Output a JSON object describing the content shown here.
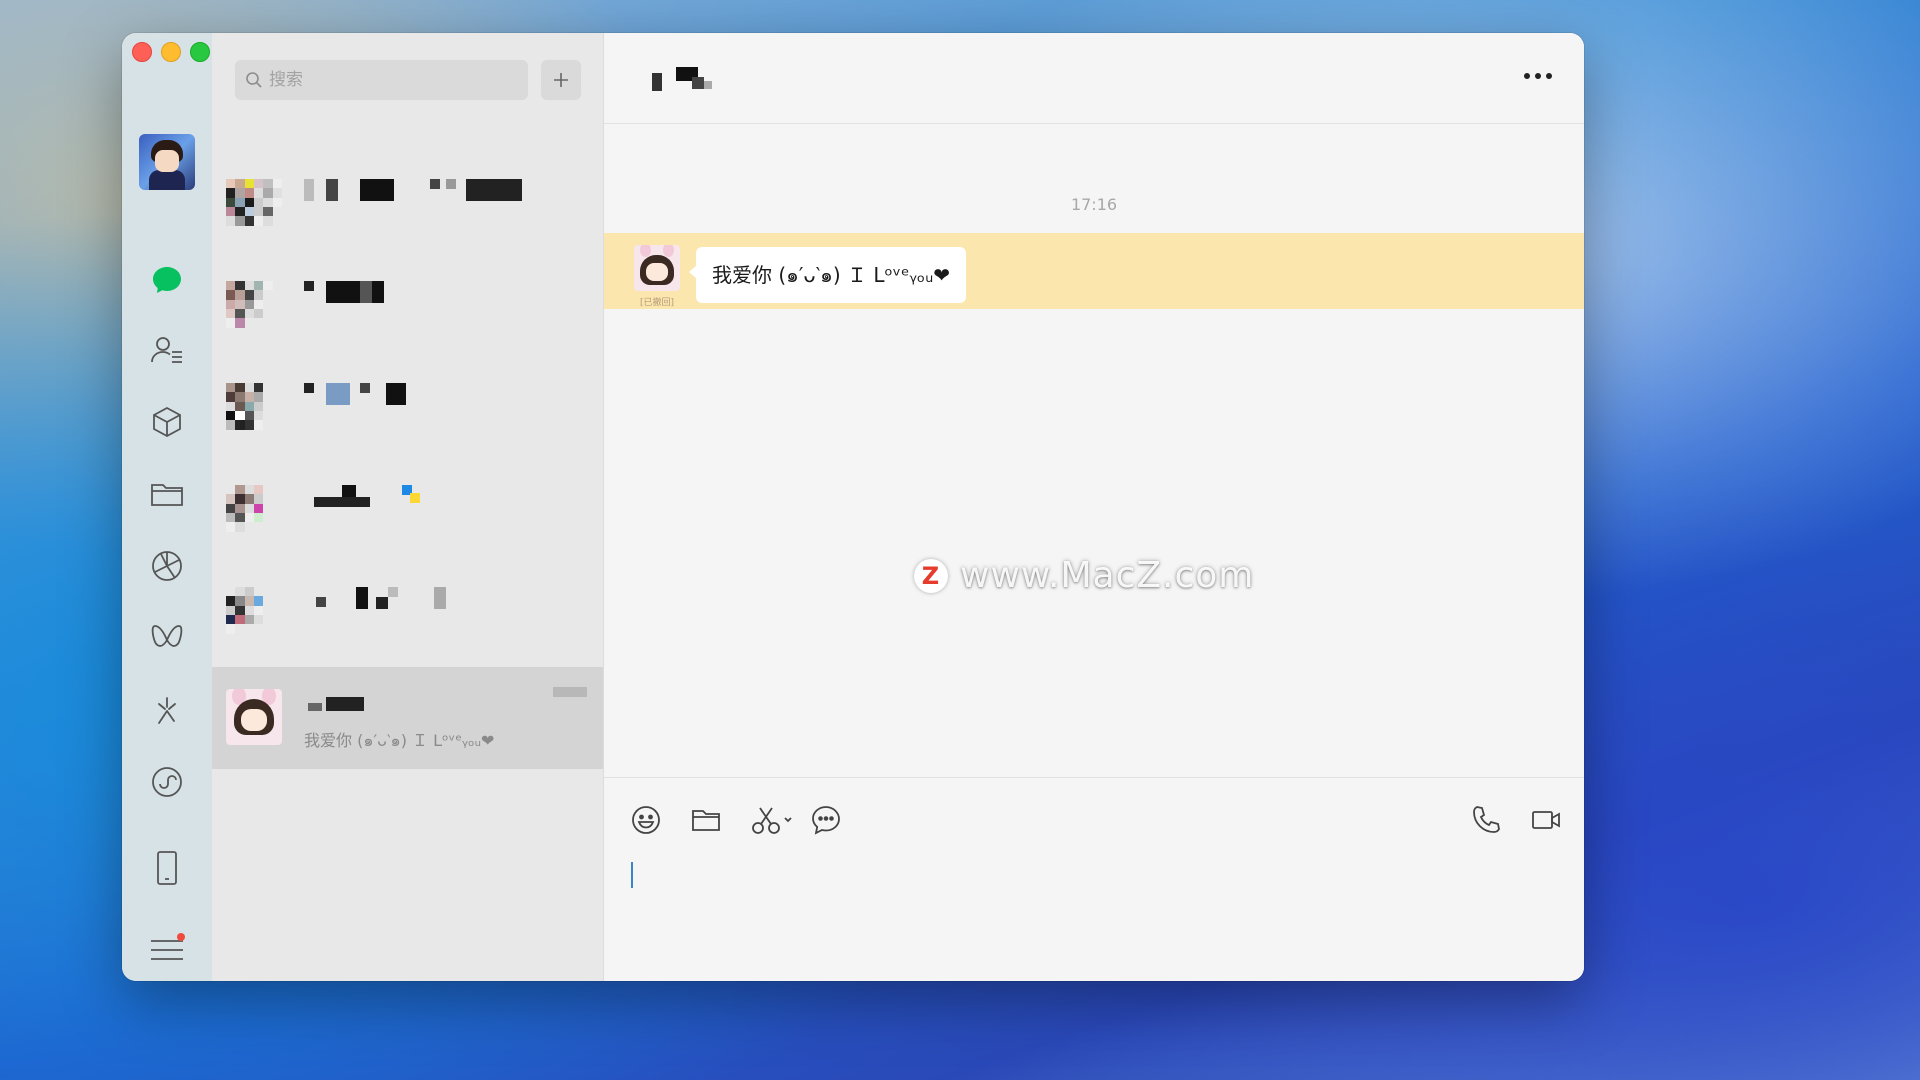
{
  "window": {
    "controls": [
      "close",
      "minimize",
      "zoom"
    ]
  },
  "rail": {
    "items": [
      {
        "icon": "chat-icon",
        "active": true,
        "color": "#07c160"
      },
      {
        "icon": "contacts-icon"
      },
      {
        "icon": "cube-icon"
      },
      {
        "icon": "folder-icon"
      },
      {
        "icon": "moments-aperture-icon"
      },
      {
        "icon": "channels-butterfly-icon"
      },
      {
        "icon": "search-spark-icon"
      },
      {
        "icon": "mini-program-icon"
      },
      {
        "icon": "phone-device-icon"
      },
      {
        "icon": "menu-icon",
        "badge": true,
        "badge_color": "#f04a3c"
      }
    ]
  },
  "list": {
    "search_placeholder": "搜索",
    "selected_preview": "我爱你 (๑′ᴗ‵๑) Ｉ Lᵒᵛᵉᵧₒᵤ❤"
  },
  "chat": {
    "timestamp": "17:16",
    "revoked_label": "[已撤回]",
    "message_text": "我爱你 (๑′ᴗ‵๑) Ｉ Lᵒᵛᵉᵧₒᵤ❤",
    "highlight_color": "#fbe7ad"
  },
  "watermark": {
    "logo": "Z",
    "text": "www.MacZ.com"
  }
}
